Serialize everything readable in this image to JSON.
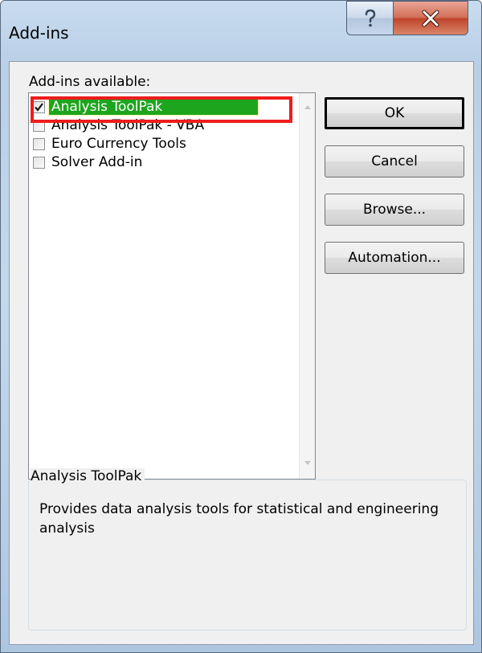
{
  "dialog": {
    "title": "Add-ins",
    "help_icon": "help-icon",
    "close_icon": "close-icon"
  },
  "list": {
    "label": "Add-ins available:",
    "items": [
      {
        "label": "Analysis ToolPak",
        "checked": true,
        "selected": true
      },
      {
        "label": "Analysis ToolPak - VBA",
        "checked": false,
        "selected": false
      },
      {
        "label": "Euro Currency Tools",
        "checked": false,
        "selected": false
      },
      {
        "label": "Solver Add-in",
        "checked": false,
        "selected": false
      }
    ]
  },
  "buttons": {
    "ok": "OK",
    "cancel": "Cancel",
    "browse": "Browse...",
    "automation": "Automation..."
  },
  "description": {
    "group_title": "Analysis ToolPak",
    "text": "Provides data analysis tools for statistical and engineering analysis"
  },
  "colors": {
    "selection": "#1ea51e",
    "highlight_outline": "#ee1c1c",
    "checkmark": "#1a1a1a"
  }
}
